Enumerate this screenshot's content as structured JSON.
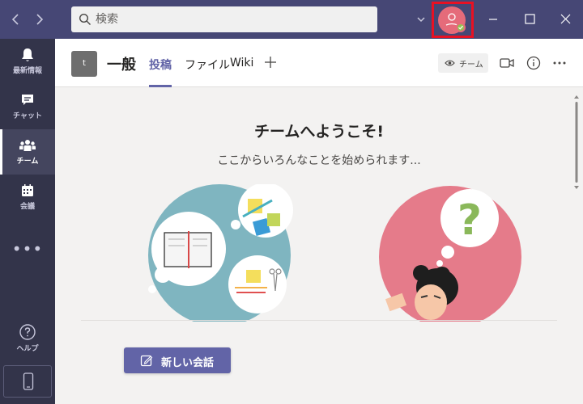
{
  "search": {
    "placeholder": "検索"
  },
  "rail": {
    "items": [
      {
        "label": "最新情報",
        "icon": "bell-icon"
      },
      {
        "label": "チャット",
        "icon": "chat-icon"
      },
      {
        "label": "チーム",
        "icon": "teams-icon"
      },
      {
        "label": "会議",
        "icon": "calendar-icon"
      }
    ],
    "more": "•••",
    "help_label": "ヘルプ"
  },
  "channel": {
    "team_initial": "t",
    "name": "一般",
    "tabs": [
      {
        "label": "投稿",
        "active": true
      },
      {
        "label": "ファイル",
        "active": false
      },
      {
        "label": "Wiki",
        "active": false
      }
    ],
    "team_pill_label": "チーム"
  },
  "welcome": {
    "title": "チームへようこそ!",
    "subtitle": "ここからいろんなことを始められます..."
  },
  "new_conversation_label": "新しい会話",
  "colors": {
    "titlebar": "#464775",
    "rail": "#33344a",
    "accent": "#6264a7",
    "highlight_box": "#e81123",
    "status_available": "#92c353"
  }
}
